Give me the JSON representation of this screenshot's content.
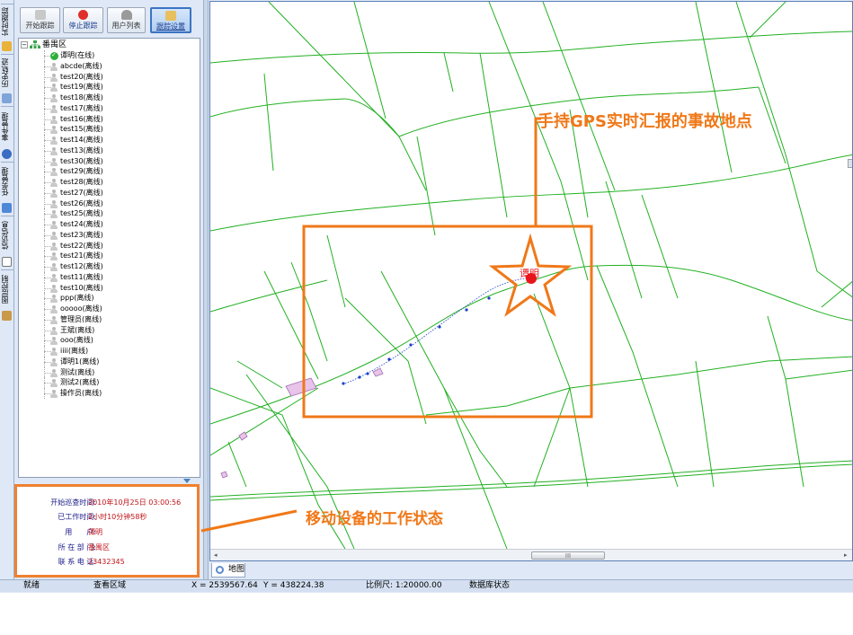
{
  "vertical_tabs": [
    {
      "label": "实时跟踪"
    },
    {
      "label": "历史轨迹"
    },
    {
      "label": "事件管理"
    },
    {
      "label": "任务管理"
    },
    {
      "label": "信访信息"
    },
    {
      "label": "图层控制"
    }
  ],
  "toolbar": {
    "start_label": "开始跟踪",
    "stop_label": "停止跟踪",
    "users_label": "用户列表",
    "settings_label": "跟踪设置"
  },
  "tree": {
    "root_label": "番禺区",
    "items": [
      {
        "label": "谭明(在线)",
        "online": true
      },
      {
        "label": "abcde(离线)",
        "online": false
      },
      {
        "label": "test20(离线)",
        "online": false
      },
      {
        "label": "test19(离线)",
        "online": false
      },
      {
        "label": "test18(离线)",
        "online": false
      },
      {
        "label": "test17(离线)",
        "online": false
      },
      {
        "label": "test16(离线)",
        "online": false
      },
      {
        "label": "test15(离线)",
        "online": false
      },
      {
        "label": "test14(离线)",
        "online": false
      },
      {
        "label": "test13(离线)",
        "online": false
      },
      {
        "label": "test30(离线)",
        "online": false
      },
      {
        "label": "test29(离线)",
        "online": false
      },
      {
        "label": "test28(离线)",
        "online": false
      },
      {
        "label": "test27(离线)",
        "online": false
      },
      {
        "label": "test26(离线)",
        "online": false
      },
      {
        "label": "test25(离线)",
        "online": false
      },
      {
        "label": "test24(离线)",
        "online": false
      },
      {
        "label": "test23(离线)",
        "online": false
      },
      {
        "label": "test22(离线)",
        "online": false
      },
      {
        "label": "test21(离线)",
        "online": false
      },
      {
        "label": "test12(离线)",
        "online": false
      },
      {
        "label": "test11(离线)",
        "online": false
      },
      {
        "label": "test10(离线)",
        "online": false
      },
      {
        "label": "ppp(离线)",
        "online": false
      },
      {
        "label": "ooooo(离线)",
        "online": false
      },
      {
        "label": "管理员(离线)",
        "online": false
      },
      {
        "label": "王斌(离线)",
        "online": false
      },
      {
        "label": "ooo(离线)",
        "online": false
      },
      {
        "label": "iiii(离线)",
        "online": false
      },
      {
        "label": "谭明1(离线)",
        "online": false
      },
      {
        "label": "测试(离线)",
        "online": false
      },
      {
        "label": "测试2(离线)",
        "online": false
      },
      {
        "label": "操作员(离线)",
        "online": false
      }
    ]
  },
  "status_info": {
    "start_time_label": "开始巡查时间:",
    "start_time_value": "2010年10月25日 03:00:56",
    "worked_label": "已工作时间:",
    "worked_value": "2小时10分钟58秒",
    "user_label": "用　　户:",
    "user_value": "谭明",
    "dept_label": "所 在 部 门:",
    "dept_value": "番禺区",
    "phone_label": "联 系 电 话:",
    "phone_value": "23432345"
  },
  "map": {
    "marker_label": "谭明",
    "tab_label": "地图",
    "scroll_thumb": "III"
  },
  "statusbar": {
    "ready": "就绪",
    "mode": "查看区域",
    "x": "X = 2539567.64",
    "y": "Y = 438224.38",
    "scale": "比例尺: 1:20000.00",
    "db": "数据库状态"
  },
  "annotations": {
    "gps_note": "手持GPS实时汇报的事故地点",
    "device_note": "移动设备的工作状态"
  },
  "colors": {
    "road": "#22b022",
    "annotation": "#f07818",
    "track": "#1a3fc8",
    "marker": "#e8141b"
  }
}
